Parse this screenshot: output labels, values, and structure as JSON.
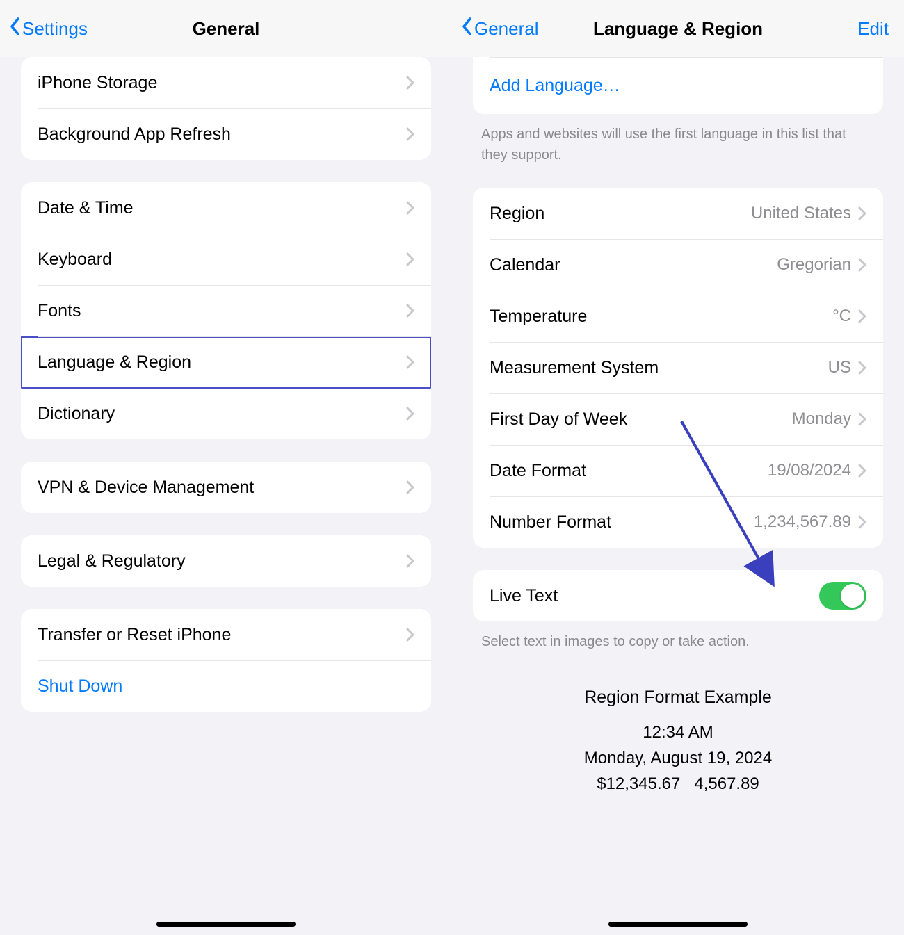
{
  "left": {
    "back": "Settings",
    "title": "General",
    "groups": [
      {
        "rows": [
          {
            "label": "iPhone Storage"
          },
          {
            "label": "Background App Refresh"
          }
        ]
      },
      {
        "rows": [
          {
            "label": "Date & Time"
          },
          {
            "label": "Keyboard"
          },
          {
            "label": "Fonts"
          },
          {
            "label": "Language & Region",
            "highlighted": true
          },
          {
            "label": "Dictionary"
          }
        ]
      },
      {
        "rows": [
          {
            "label": "VPN & Device Management"
          }
        ]
      },
      {
        "rows": [
          {
            "label": "Legal & Regulatory"
          }
        ]
      },
      {
        "rows": [
          {
            "label": "Transfer or Reset iPhone"
          },
          {
            "label": "Shut Down",
            "link": true,
            "noChevron": true
          }
        ]
      }
    ]
  },
  "right": {
    "back": "General",
    "title": "Language & Region",
    "edit": "Edit",
    "addLanguage": "Add Language…",
    "languageFooter": "Apps and websites will use the first language in this list that they support.",
    "region": {
      "label": "Region",
      "value": "United States"
    },
    "calendar": {
      "label": "Calendar",
      "value": "Gregorian"
    },
    "temperature": {
      "label": "Temperature",
      "value": "°C"
    },
    "measurement": {
      "label": "Measurement System",
      "value": "US"
    },
    "firstDay": {
      "label": "First Day of Week",
      "value": "Monday"
    },
    "dateFormat": {
      "label": "Date Format",
      "value": "19/08/2024"
    },
    "numberFormat": {
      "label": "Number Format",
      "value": "1,234,567.89"
    },
    "liveText": {
      "label": "Live Text",
      "on": true
    },
    "liveTextFooter": "Select text in images to copy or take action.",
    "example": {
      "title": "Region Format Example",
      "time": "12:34 AM",
      "date": "Monday, August 19, 2024",
      "currency": "$12,345.67",
      "number": "4,567.89"
    }
  }
}
